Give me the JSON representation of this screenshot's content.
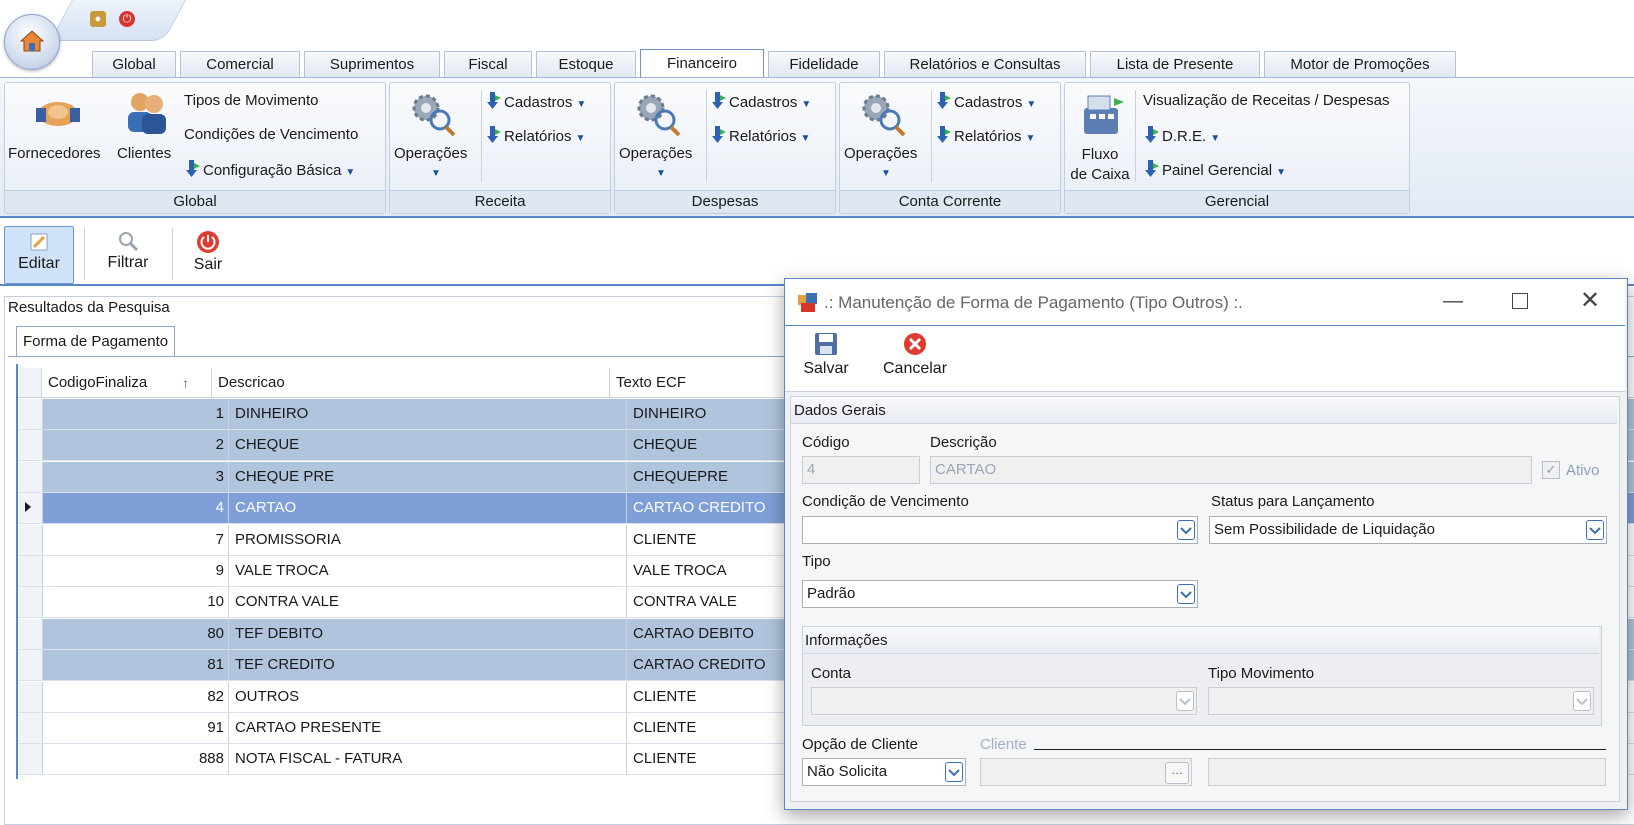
{
  "tabs": [
    "Global",
    "Comercial",
    "Suprimentos",
    "Fiscal",
    "Estoque",
    "Financeiro",
    "Fidelidade",
    "Relatórios e Consultas",
    "Lista de Presente",
    "Motor de Promoções"
  ],
  "active_tab": "Financeiro",
  "ribbon": {
    "global": {
      "label": "Global",
      "fornecedores": "Fornecedores",
      "clientes": "Clientes",
      "tipos_movimento": "Tipos de Movimento",
      "condicoes_vencimento": "Condições de Vencimento",
      "configuracao_basica": "Configuração Básica"
    },
    "receita": {
      "label": "Receita",
      "operacoes": "Operações",
      "cadastros": "Cadastros",
      "relatorios": "Relatórios"
    },
    "despesas": {
      "label": "Despesas",
      "operacoes": "Operações",
      "cadastros": "Cadastros",
      "relatorios": "Relatórios"
    },
    "conta_corrente": {
      "label": "Conta Corrente",
      "operacoes": "Operações",
      "cadastros": "Cadastros",
      "relatorios": "Relatórios"
    },
    "gerencial": {
      "label": "Gerencial",
      "fluxo_line1": "Fluxo",
      "fluxo_line2": "de Caixa",
      "visualizacao": "Visualização de Receitas / Despesas",
      "dre": "D.R.E.",
      "painel": "Painel Gerencial"
    }
  },
  "toolbar": {
    "editar": "Editar",
    "filtrar": "Filtrar",
    "sair": "Sair"
  },
  "results": {
    "title": "Resultados da Pesquisa",
    "tab": "Forma de Pagamento",
    "columns": [
      "CodigoFinaliza",
      "Descricao",
      "Texto ECF"
    ],
    "rows": [
      {
        "codigo": "1",
        "descricao": "DINHEIRO",
        "texto": "DINHEIRO",
        "state": "sel"
      },
      {
        "codigo": "2",
        "descricao": "CHEQUE",
        "texto": "CHEQUE",
        "state": "sel"
      },
      {
        "codigo": "3",
        "descricao": "CHEQUE PRE",
        "texto": "CHEQUEPRE",
        "state": "sel"
      },
      {
        "codigo": "4",
        "descricao": "CARTAO",
        "texto": "CARTAO CREDITO",
        "state": "cur"
      },
      {
        "codigo": "7",
        "descricao": "PROMISSORIA",
        "texto": "CLIENTE",
        "state": ""
      },
      {
        "codigo": "9",
        "descricao": "VALE TROCA",
        "texto": "VALE TROCA",
        "state": ""
      },
      {
        "codigo": "10",
        "descricao": "CONTRA VALE",
        "texto": "CONTRA VALE",
        "state": ""
      },
      {
        "codigo": "80",
        "descricao": "TEF DEBITO",
        "texto": "CARTAO DEBITO",
        "state": "sel"
      },
      {
        "codigo": "81",
        "descricao": "TEF CREDITO",
        "texto": "CARTAO CREDITO",
        "state": "sel"
      },
      {
        "codigo": "82",
        "descricao": "OUTROS",
        "texto": "CLIENTE",
        "state": ""
      },
      {
        "codigo": "91",
        "descricao": "CARTAO PRESENTE",
        "texto": "CLIENTE",
        "state": ""
      },
      {
        "codigo": "888",
        "descricao": "NOTA FISCAL - FATURA",
        "texto": "CLIENTE",
        "state": ""
      }
    ]
  },
  "dialog": {
    "title": ".: Manutenção de Forma de Pagamento (Tipo Outros) :.",
    "salvar": "Salvar",
    "cancelar": "Cancelar",
    "section": "Dados Gerais",
    "codigo_label": "Código",
    "codigo_value": "4",
    "descricao_label": "Descrição",
    "descricao_value": "CARTAO",
    "ativo_label": "Ativo",
    "condicao_label": "Condição de Vencimento",
    "condicao_value": "",
    "status_label": "Status para Lançamento",
    "status_value": "Sem Possibilidade de Liquidação",
    "tipo_label": "Tipo",
    "tipo_value": "Padrão",
    "informacoes": "Informações",
    "conta_label": "Conta",
    "tipo_mov_label": "Tipo Movimento",
    "opcao_cliente_label": "Opção de Cliente",
    "opcao_cliente_value": "Não Solicita",
    "cliente_label": "Cliente"
  },
  "colors": {
    "accent": "#5b87c6",
    "selected_row": "#b0c4dd",
    "current_row": "#7f9fd8"
  }
}
